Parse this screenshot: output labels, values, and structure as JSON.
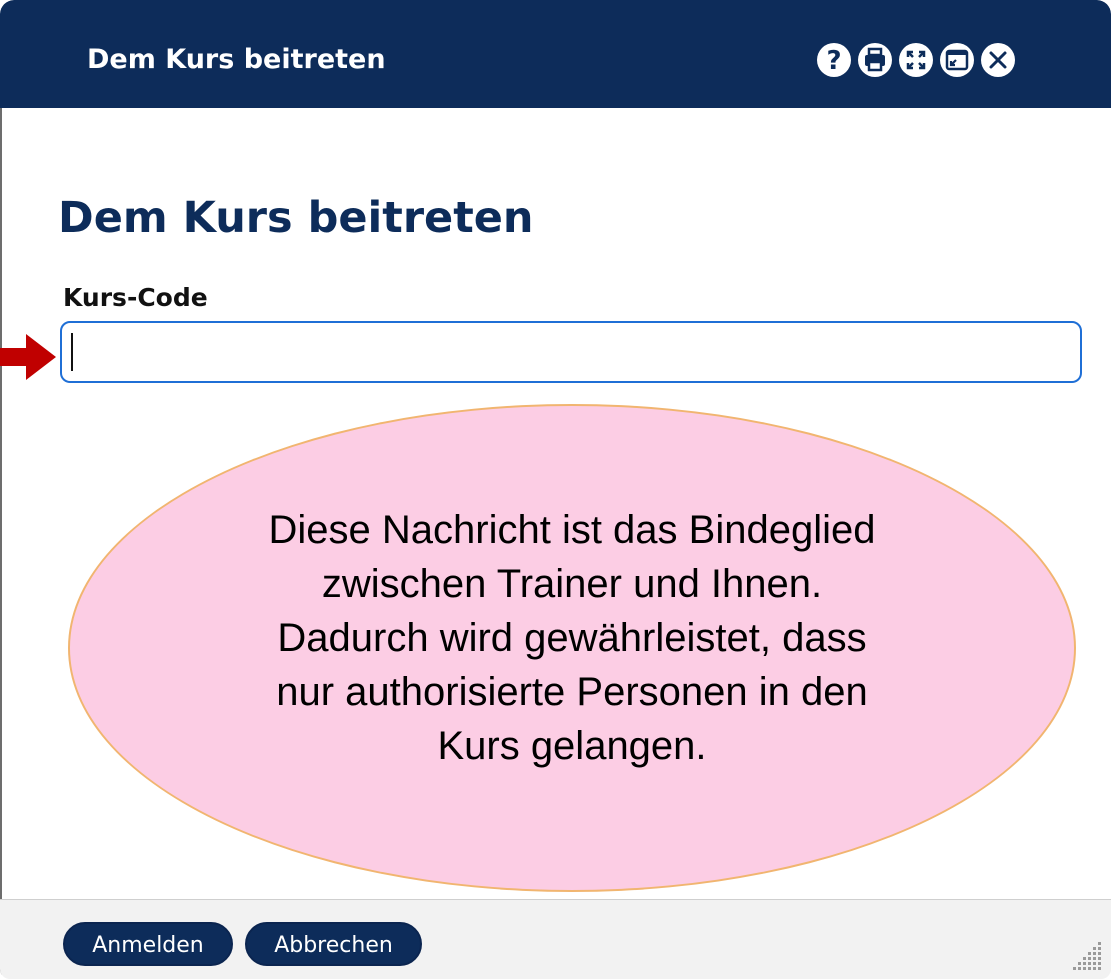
{
  "window": {
    "title": "Dem Kurs beitreten",
    "toolbar": [
      "help-icon",
      "print-icon",
      "fullscreen-icon",
      "window-mode-icon",
      "close-icon"
    ]
  },
  "form": {
    "heading": "Dem Kurs beitreten",
    "field_label": "Kurs-Code",
    "field_value": ""
  },
  "callout": {
    "lines": [
      "Diese Nachricht ist das Bindeglied",
      "zwischen Trainer und Ihnen.",
      "Dadurch wird gewährleistet, dass",
      "nur authorisierte Personen in den",
      "Kurs gelangen."
    ]
  },
  "footer": {
    "submit_label": "Anmelden",
    "cancel_label": "Abbrechen"
  },
  "colors": {
    "titlebar": "#0d2c5a",
    "heading": "#0d2c5a",
    "input_border": "#1f6fd6",
    "callout_fill": "#fccde4",
    "callout_border": "#f1b570",
    "arrow": "#c00000"
  }
}
